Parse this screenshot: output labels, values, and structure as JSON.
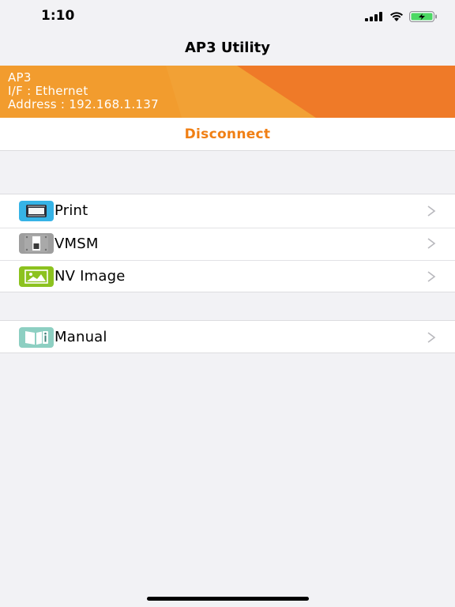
{
  "status_bar": {
    "time": "1:10",
    "icons": [
      "cellular-signal-icon",
      "wifi-icon",
      "battery-charging-icon"
    ],
    "battery_color": "#4cd964"
  },
  "nav": {
    "title": "AP3 Utility"
  },
  "device": {
    "name": "AP3",
    "interface": "I/F : Ethernet",
    "address": "Address : 192.168.1.137",
    "colors": {
      "banner_light": "#f29c2e",
      "banner_dark": "#ef7a28"
    }
  },
  "actions": {
    "disconnect_label": "Disconnect",
    "accent_color": "#f07f14"
  },
  "menu": {
    "groups": [
      {
        "items": [
          {
            "label": "Print",
            "icon": "printer-icon",
            "color": "#36b3e6"
          },
          {
            "label": "VMSM",
            "icon": "switch-icon",
            "color": "#9e9e9e"
          },
          {
            "label": "NV Image",
            "icon": "image-icon",
            "color": "#8cc21f"
          }
        ]
      },
      {
        "items": [
          {
            "label": "Manual",
            "icon": "book-info-icon",
            "color": "#8dcfc2"
          }
        ]
      }
    ]
  }
}
